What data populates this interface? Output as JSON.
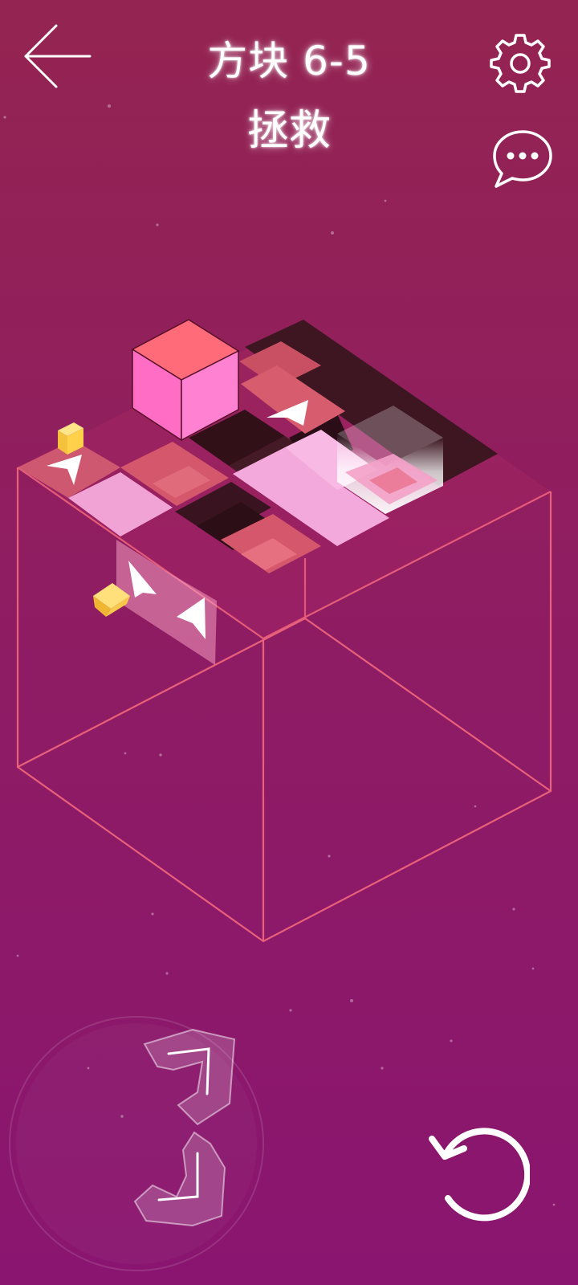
{
  "header": {
    "level_title": "方块 6-5",
    "level_subtitle": "拯救"
  },
  "icons": {
    "back": "back-arrow-icon",
    "settings": "gear-icon",
    "chat": "speech-bubble-icon",
    "undo": "undo-icon",
    "dpad": "direction-pad-icon"
  },
  "colors": {
    "background_top": "#942451",
    "background_bottom": "#8a1570",
    "cube_outline": "#e8607a",
    "player_cube": "#ff6b7a",
    "collectible": "#ffd24a",
    "dark_tile": "#3b1420",
    "pink_tile": "#f4a6d6",
    "red_tile": "#e45a6e"
  }
}
